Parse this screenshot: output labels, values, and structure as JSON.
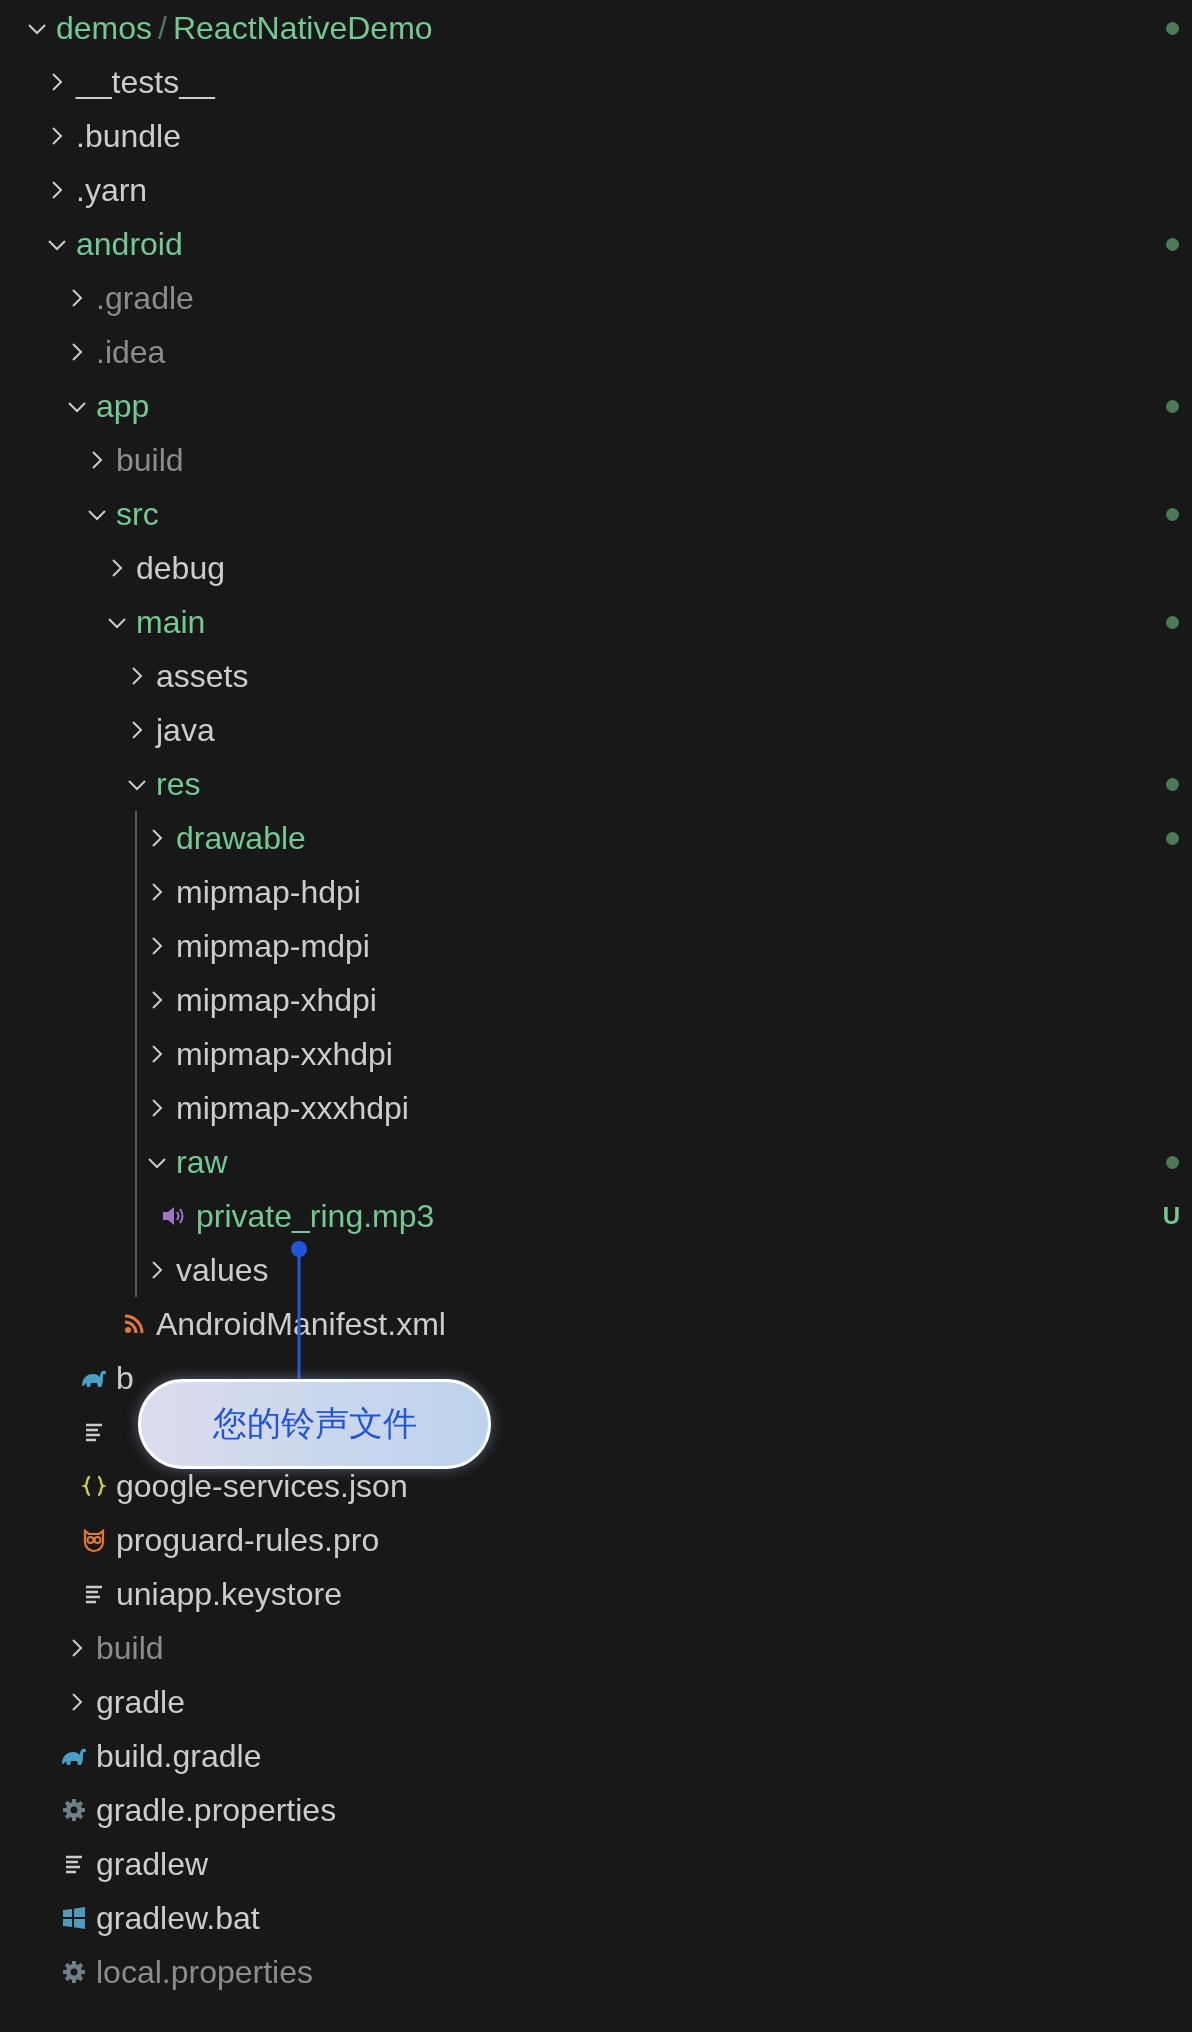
{
  "explorer": {
    "root": {
      "owner": "demos",
      "separator": "/",
      "name": "ReactNativeDemo",
      "kind": "folder",
      "expanded": true,
      "color": "#73c991",
      "modified_dot": true,
      "children": [
        {
          "name": "__tests__",
          "kind": "folder",
          "expanded": false,
          "color": "#cccccc"
        },
        {
          "name": ".bundle",
          "kind": "folder",
          "expanded": false,
          "color": "#cccccc"
        },
        {
          "name": ".yarn",
          "kind": "folder",
          "expanded": false,
          "color": "#cccccc"
        },
        {
          "name": "android",
          "kind": "folder",
          "expanded": true,
          "color": "#73c991",
          "modified_dot": true,
          "children": [
            {
              "name": ".gradle",
              "kind": "folder",
              "expanded": false,
              "color": "#8c8c8c"
            },
            {
              "name": ".idea",
              "kind": "folder",
              "expanded": false,
              "color": "#8c8c8c"
            },
            {
              "name": "app",
              "kind": "folder",
              "expanded": true,
              "color": "#73c991",
              "modified_dot": true,
              "children": [
                {
                  "name": "build",
                  "kind": "folder",
                  "expanded": false,
                  "color": "#8c8c8c"
                },
                {
                  "name": "src",
                  "kind": "folder",
                  "expanded": true,
                  "color": "#73c991",
                  "modified_dot": true,
                  "children": [
                    {
                      "name": "debug",
                      "kind": "folder",
                      "expanded": false,
                      "color": "#cccccc"
                    },
                    {
                      "name": "main",
                      "kind": "folder",
                      "expanded": true,
                      "color": "#73c991",
                      "modified_dot": true,
                      "children": [
                        {
                          "name": "assets",
                          "kind": "folder",
                          "expanded": false,
                          "color": "#cccccc"
                        },
                        {
                          "name": "java",
                          "kind": "folder",
                          "expanded": false,
                          "color": "#cccccc"
                        },
                        {
                          "name": "res",
                          "kind": "folder",
                          "expanded": true,
                          "color": "#73c991",
                          "modified_dot": true,
                          "indent_guide": true,
                          "children": [
                            {
                              "name": "drawable",
                              "kind": "folder",
                              "expanded": false,
                              "color": "#73c991",
                              "modified_dot": true
                            },
                            {
                              "name": "mipmap-hdpi",
                              "kind": "folder",
                              "expanded": false,
                              "color": "#cccccc"
                            },
                            {
                              "name": "mipmap-mdpi",
                              "kind": "folder",
                              "expanded": false,
                              "color": "#cccccc"
                            },
                            {
                              "name": "mipmap-xhdpi",
                              "kind": "folder",
                              "expanded": false,
                              "color": "#cccccc"
                            },
                            {
                              "name": "mipmap-xxhdpi",
                              "kind": "folder",
                              "expanded": false,
                              "color": "#cccccc"
                            },
                            {
                              "name": "mipmap-xxxhdpi",
                              "kind": "folder",
                              "expanded": false,
                              "color": "#cccccc"
                            },
                            {
                              "name": "raw",
                              "kind": "folder",
                              "expanded": true,
                              "color": "#73c991",
                              "modified_dot": true,
                              "children": [
                                {
                                  "name": "private_ring.mp3",
                                  "kind": "audio",
                                  "color": "#73c991",
                                  "badge": "U"
                                }
                              ]
                            },
                            {
                              "name": "values",
                              "kind": "folder",
                              "expanded": false,
                              "color": "#cccccc"
                            }
                          ]
                        },
                        {
                          "name": "AndroidManifest.xml",
                          "kind": "manifest",
                          "color": "#cccccc"
                        }
                      ]
                    }
                  ]
                },
                {
                  "name": "b",
                  "kind": "gradle",
                  "color": "#cccccc"
                },
                {
                  "kind": "text"
                },
                {
                  "name": "google-services.json",
                  "kind": "json",
                  "color": "#cccccc"
                },
                {
                  "name": "proguard-rules.pro",
                  "kind": "proguard",
                  "color": "#cccccc"
                },
                {
                  "name": "uniapp.keystore",
                  "kind": "text",
                  "color": "#cccccc"
                }
              ]
            },
            {
              "name": "build",
              "kind": "folder",
              "expanded": false,
              "color": "#8c8c8c"
            },
            {
              "name": "gradle",
              "kind": "folder",
              "expanded": false,
              "color": "#cccccc"
            },
            {
              "name": "build.gradle",
              "kind": "gradle",
              "color": "#cccccc"
            },
            {
              "name": "gradle.properties",
              "kind": "properties",
              "color": "#cccccc"
            },
            {
              "name": "gradlew",
              "kind": "text",
              "color": "#cccccc"
            },
            {
              "name": "gradlew.bat",
              "kind": "batch",
              "color": "#cccccc"
            },
            {
              "name": "local.properties",
              "kind": "properties",
              "color": "#8c8c8c"
            }
          ]
        }
      ]
    }
  },
  "callout": {
    "text": "您的铃声文件"
  }
}
